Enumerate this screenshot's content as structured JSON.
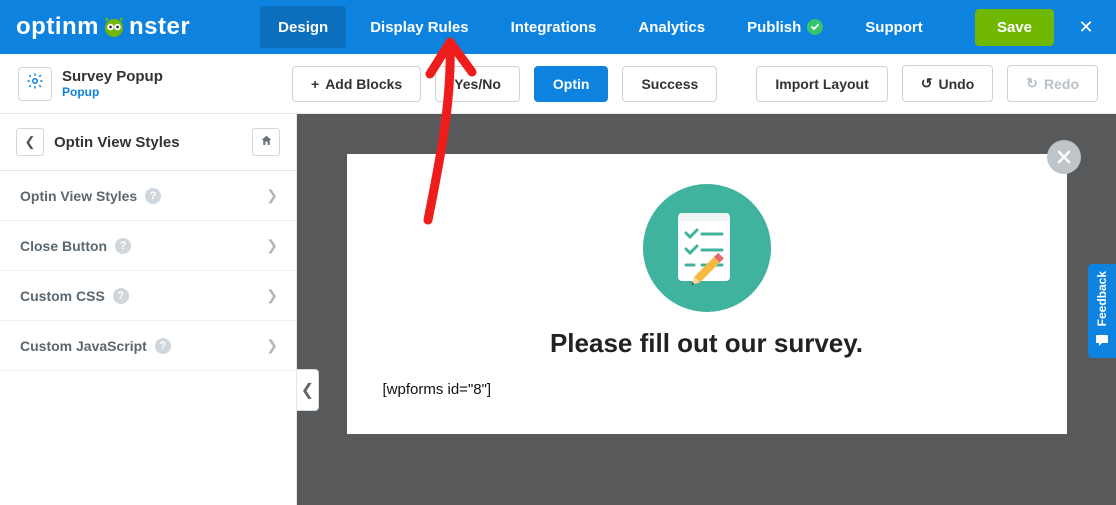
{
  "brand": "optinmonster",
  "topnav": {
    "design": "Design",
    "display_rules": "Display Rules",
    "integrations": "Integrations",
    "analytics": "Analytics",
    "publish": "Publish",
    "support": "Support",
    "save": "Save"
  },
  "campaign": {
    "name": "Survey Popup",
    "type": "Popup"
  },
  "toolbar": {
    "add_blocks": "Add Blocks",
    "yes_no": "Yes/No",
    "optin": "Optin",
    "success": "Success",
    "import_layout": "Import Layout",
    "undo": "Undo",
    "redo": "Redo"
  },
  "sidebar": {
    "heading": "Optin View Styles",
    "items": [
      {
        "label": "Optin View Styles"
      },
      {
        "label": "Close Button"
      },
      {
        "label": "Custom CSS"
      },
      {
        "label": "Custom JavaScript"
      }
    ]
  },
  "popup": {
    "heading": "Please fill out our survey.",
    "shortcode": "[wpforms id=\"8\"]"
  },
  "feedback_label": "Feedback"
}
